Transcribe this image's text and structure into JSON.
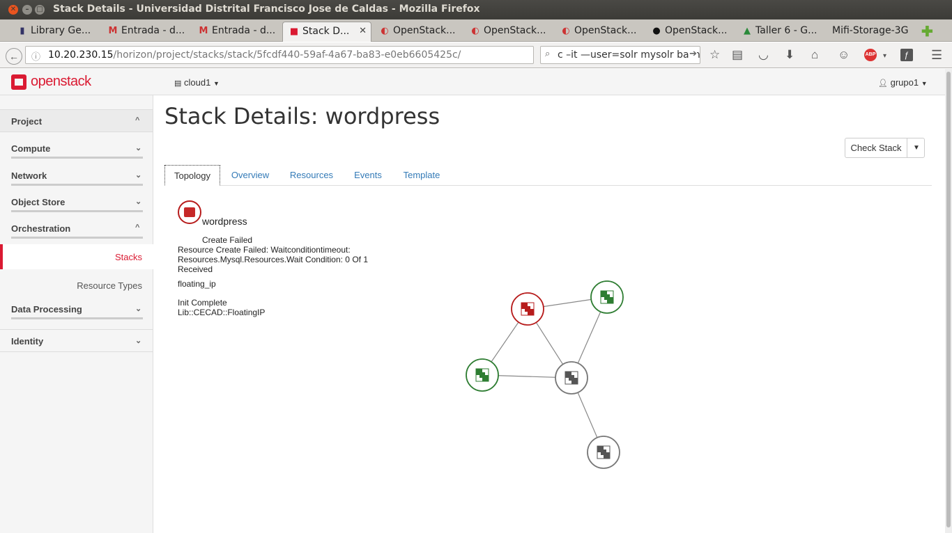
{
  "window": {
    "title": "Stack Details - Universidad Distrital Francisco Jose de Caldas - Mozilla Firefox"
  },
  "browser_tabs": [
    {
      "label": "Library Ge...",
      "icon": "library-icon"
    },
    {
      "label": "Entrada - d...",
      "icon": "gmail-icon"
    },
    {
      "label": "Entrada - d...",
      "icon": "gmail-icon"
    },
    {
      "label": "Stack D...",
      "icon": "openstack-icon",
      "active": true
    },
    {
      "label": "OpenStack...",
      "icon": "openstack-icon"
    },
    {
      "label": "OpenStack...",
      "icon": "openstack-icon"
    },
    {
      "label": "OpenStack...",
      "icon": "openstack-icon"
    },
    {
      "label": "OpenStack...",
      "icon": "github-icon"
    },
    {
      "label": "Taller 6 - G...",
      "icon": "drive-icon"
    },
    {
      "label": "Mifi-Storage-3G",
      "icon": ""
    }
  ],
  "urlbar": {
    "host": "10.20.230.15",
    "path": "/horizon/project/stacks/stack/5fcdf440-59af-4a67-ba83-e0eb6605425c/"
  },
  "searchbar": {
    "value": "c –it —user=solr mysolr bash"
  },
  "toolbar": {
    "abp_label": "ABP"
  },
  "header": {
    "logo_text": "openstack",
    "cloud_selector": "cloud1",
    "user_menu": "grupo1"
  },
  "sidebar": {
    "sections": [
      {
        "label": "Project"
      },
      {
        "label": "Compute"
      },
      {
        "label": "Network"
      },
      {
        "label": "Object Store"
      },
      {
        "label": "Orchestration"
      },
      {
        "label": "Data Processing"
      },
      {
        "label": "Identity"
      }
    ],
    "orchestration_items": [
      {
        "label": "Stacks",
        "active": true
      },
      {
        "label": "Resource Types"
      }
    ]
  },
  "page": {
    "title": "Stack Details: wordpress",
    "check_stack_label": "Check Stack",
    "tabs": [
      {
        "label": "Topology",
        "active": true
      },
      {
        "label": "Overview"
      },
      {
        "label": "Resources"
      },
      {
        "label": "Events"
      },
      {
        "label": "Template"
      }
    ]
  },
  "topology_info": {
    "stack_name": "wordpress",
    "status": "Create Failed",
    "reason_line1": "Resource Create Failed: Waitconditiontimeout:",
    "reason_line2": "Resources.Mysql.Resources.Wait Condition: 0 Of 1",
    "reason_line3": "Received",
    "resource_name": "floating_ip",
    "resource_status": "Init Complete",
    "resource_type": "Lib::CECAD::FloatingIP"
  },
  "colors": {
    "failed": "#b71c1c",
    "complete": "#2e7d32",
    "init": "#777777",
    "accent": "#da1a32",
    "link": "#337ab7"
  }
}
